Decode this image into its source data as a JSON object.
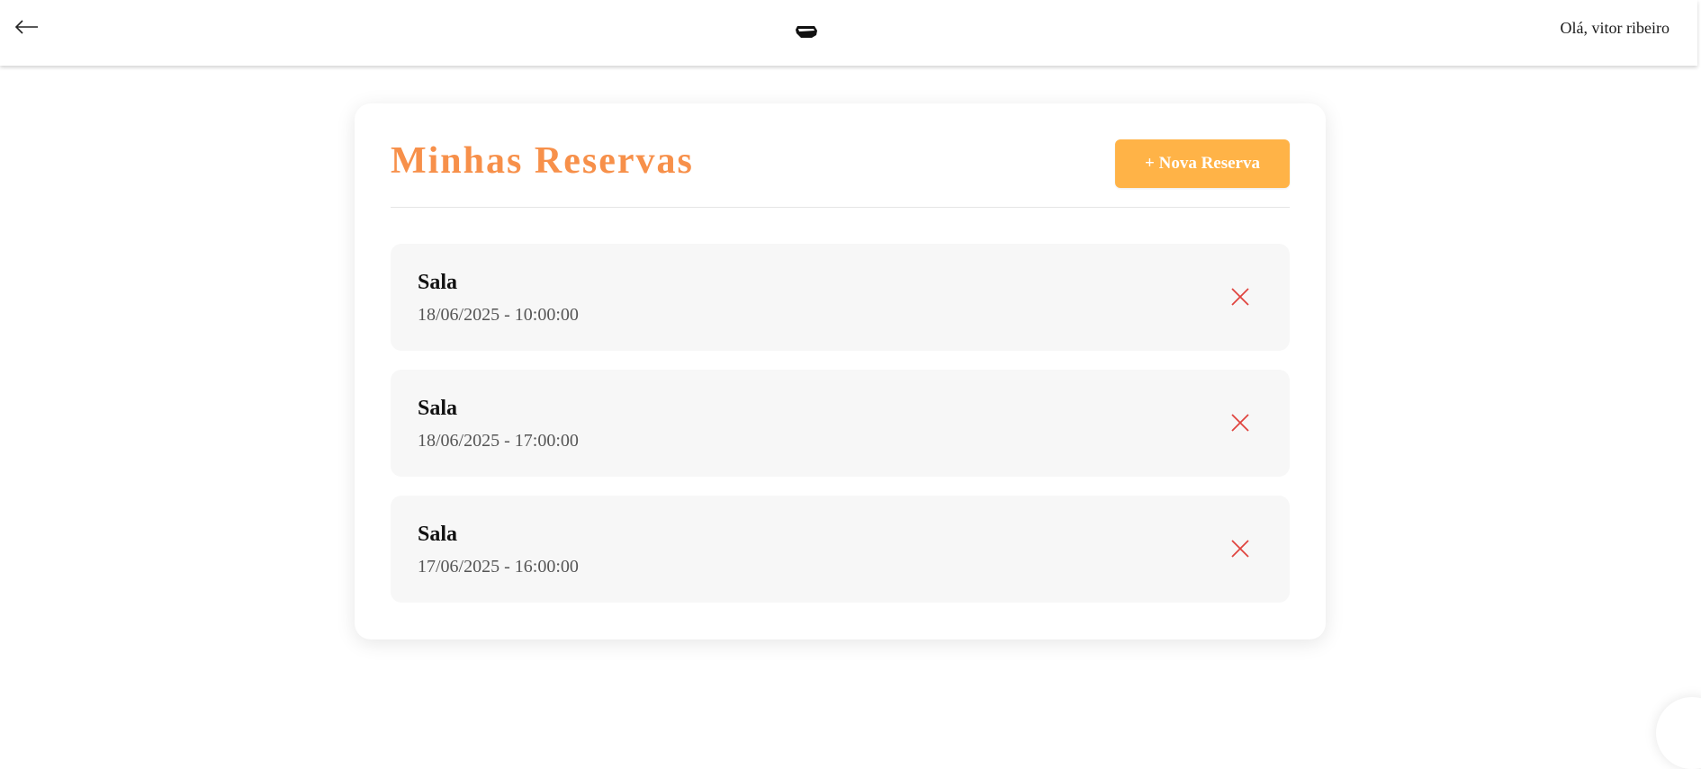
{
  "header": {
    "back_icon": "arrow-left-icon",
    "logo_icon": "brand-logo-icon",
    "greeting": "Olá, vitor ribeiro"
  },
  "main": {
    "title": "Minhas Reservas",
    "new_button_label": "+ Nova Reserva",
    "reservations": [
      {
        "name": "Sala",
        "datetime": "18/06/2025 - 10:00:00",
        "cancel_icon": "close-icon"
      },
      {
        "name": "Sala",
        "datetime": "18/06/2025 - 17:00:00",
        "cancel_icon": "close-icon"
      },
      {
        "name": "Sala",
        "datetime": "17/06/2025 - 16:00:00",
        "cancel_icon": "close-icon"
      }
    ]
  },
  "colors": {
    "accent_title": "#f7904a",
    "button_bg": "#ffb347",
    "cancel_icon": "#e0443e",
    "item_bg": "#f7f7f7"
  }
}
